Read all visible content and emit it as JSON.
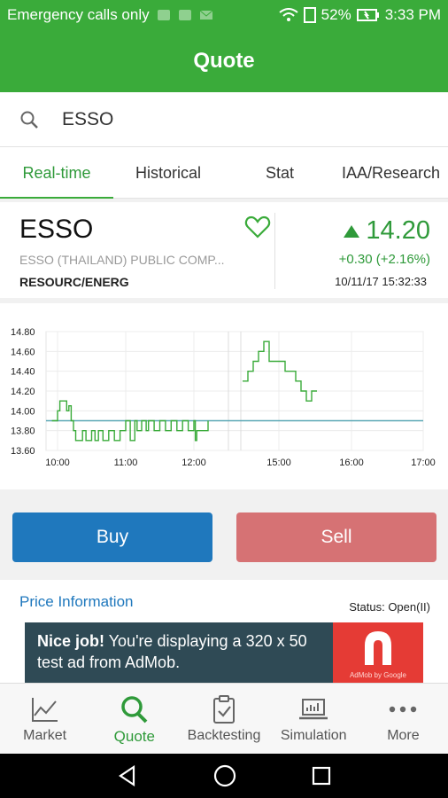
{
  "status_bar": {
    "carrier": "Emergency calls only",
    "battery": "52%",
    "time": "3:33 PM"
  },
  "app_bar": {
    "title": "Quote"
  },
  "search": {
    "value": "ESSO",
    "icon": "search-icon"
  },
  "tabs": [
    {
      "label": "Real-time",
      "active": true
    },
    {
      "label": "Historical",
      "active": false
    },
    {
      "label": "Stat",
      "active": false
    },
    {
      "label": "IAA/Research",
      "active": false
    }
  ],
  "stock": {
    "symbol": "ESSO",
    "name": "ESSO (THAILAND) PUBLIC COMP...",
    "sector": "RESOURC/ENERG",
    "price": "14.20",
    "change": "+0.30 (+2.16%)",
    "datetime": "10/11/17  15:32:33",
    "up_color": "#2f9a3a"
  },
  "chart_data": {
    "type": "line",
    "title": "",
    "xlabel": "",
    "ylabel": "",
    "x_ticks": [
      "10:00",
      "11:00",
      "12:00",
      "15:00",
      "16:00",
      "17:00"
    ],
    "y_ticks": [
      "14.80",
      "14.60",
      "14.40",
      "14.20",
      "14.00",
      "13.80",
      "13.60"
    ],
    "ylim": [
      13.6,
      14.8
    ],
    "reference_line": 13.9,
    "grid": true,
    "series": [
      {
        "name": "",
        "color": "#3aab3a",
        "segments": [
          {
            "x": [
              "09:55",
              "10:00",
              "10:02",
              "10:05",
              "10:08",
              "10:10",
              "10:12",
              "10:14",
              "10:16",
              "10:20",
              "10:22",
              "10:25",
              "10:30",
              "10:33",
              "10:36",
              "10:40",
              "10:45",
              "10:50",
              "10:55",
              "11:00",
              "11:04",
              "11:08",
              "11:10",
              "11:14",
              "11:18",
              "11:20",
              "11:25",
              "11:30",
              "11:35",
              "11:40",
              "11:45",
              "11:50",
              "11:55",
              "12:00",
              "12:03",
              "12:06",
              "12:10",
              "12:15",
              "12:20",
              "12:25",
              "12:30"
            ],
            "y": [
              13.9,
              14.0,
              14.1,
              14.1,
              14.0,
              14.05,
              13.9,
              13.8,
              13.7,
              13.7,
              13.8,
              13.7,
              13.8,
              13.7,
              13.8,
              13.7,
              13.8,
              13.7,
              13.8,
              13.9,
              13.7,
              13.9,
              13.8,
              13.9,
              13.8,
              13.9,
              13.8,
              13.9,
              13.8,
              13.9,
              13.8,
              13.9,
              13.8,
              13.9,
              13.7,
              13.8,
              13.8,
              13.8,
              13.8,
              13.8,
              13.9
            ]
          },
          {
            "x": [
              "14:30",
              "14:35",
              "14:40",
              "14:45",
              "14:50",
              "14:55",
              "15:00",
              "15:05",
              "15:10",
              "15:15",
              "15:20",
              "15:25",
              "15:30",
              "15:35",
              "15:40"
            ],
            "y": [
              14.3,
              14.4,
              14.5,
              14.6,
              14.7,
              14.5,
              14.5,
              14.5,
              14.4,
              14.4,
              14.3,
              14.2,
              14.1,
              14.2,
              14.2
            ]
          }
        ]
      }
    ]
  },
  "actions": {
    "buy": "Buy",
    "sell": "Sell"
  },
  "info": {
    "title": "Price Information",
    "status": "Status: Open(II)"
  },
  "ad": {
    "bold": "Nice job!",
    "text": " You're displaying a 320 x 50 test ad from AdMob.",
    "brand": "AdMob by Google"
  },
  "bottom_nav": [
    {
      "label": "Market",
      "icon": "chart-line-icon",
      "active": false
    },
    {
      "label": "Quote",
      "icon": "search-icon",
      "active": true
    },
    {
      "label": "Backtesting",
      "icon": "clipboard-check-icon",
      "active": false
    },
    {
      "label": "Simulation",
      "icon": "laptop-chart-icon",
      "active": false
    },
    {
      "label": "More",
      "icon": "more-dots-icon",
      "active": false
    }
  ]
}
